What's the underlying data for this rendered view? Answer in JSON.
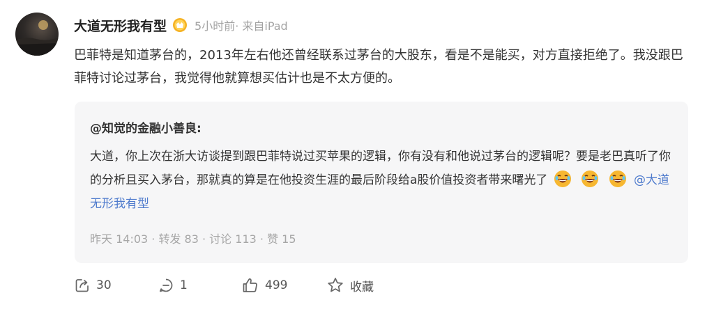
{
  "post": {
    "author": "大道无形我有型",
    "meta": "5小时前· 来自iPad",
    "text": "巴菲特是知道茅台的，2013年左右他还曾经联系过茅台的大股东，看是不是能买，对方直接拒绝了。我没跟巴菲特讨论过茅台，我觉得他就算想买估计也是不太方便的。"
  },
  "quote": {
    "author": "@知觉的金融小善良:",
    "text": "大道，你上次在浙大访谈提到跟巴菲特说过买苹果的逻辑，你有没有和他说过茅台的逻辑呢？要是老巴真听了你的分析且买入茅台，那就真的算是在他投资生涯的最后阶段给a股价值投资者带来曙光了",
    "mention": "@大道无形我有型",
    "time": "昨天 14:03",
    "repost": " · 转发 83",
    "comment": " · 讨论 113",
    "like": " · 赞 15"
  },
  "actions": {
    "share_count": "30",
    "comment_count": "1",
    "like_count": "499",
    "favorite_label": "收藏"
  },
  "icons": [
    "verified-badge-icon",
    "laughing-emoji",
    "share-icon",
    "comment-icon",
    "thumbs-up-icon",
    "star-icon"
  ],
  "colors": {
    "mention": "#4f7bcd",
    "quote_bg": "#f6f6f7",
    "badge": "#f5b223"
  }
}
